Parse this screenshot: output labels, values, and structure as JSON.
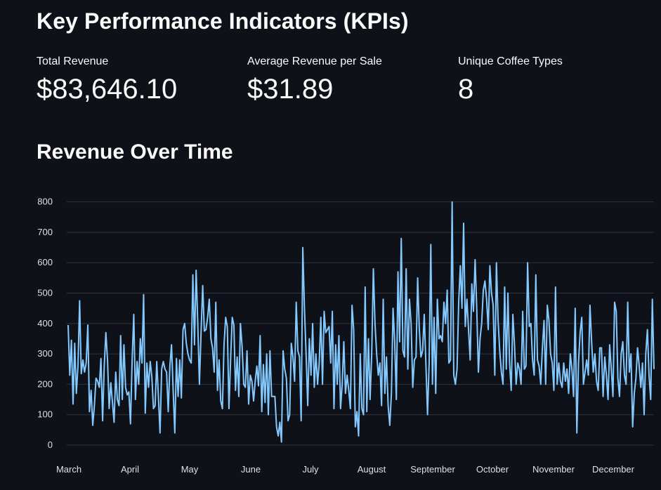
{
  "kpi_section": {
    "title": "Key Performance Indicators (KPIs)",
    "metrics": [
      {
        "label": "Total Revenue",
        "value": "$83,646.10"
      },
      {
        "label": "Average Revenue per Sale",
        "value": "$31.89"
      },
      {
        "label": "Unique Coffee Types",
        "value": "8"
      }
    ]
  },
  "revenue_section": {
    "title": "Revenue Over Time"
  },
  "colors": {
    "background": "#0e1117",
    "line": "#83c9ff",
    "grid": "#31333f",
    "tick_text": "#e0e0e0"
  },
  "chart_data": {
    "type": "line",
    "title": "",
    "xlabel": "",
    "ylabel": "",
    "ylim": [
      0,
      850
    ],
    "yticks": [
      0,
      100,
      200,
      300,
      400,
      500,
      600,
      700,
      800
    ],
    "month_labels": [
      "March",
      "April",
      "May",
      "June",
      "July",
      "August",
      "September",
      "October",
      "November",
      "December"
    ],
    "grid": true,
    "legend": "none",
    "series": [
      {
        "values": [
          395,
          230,
          345,
          135,
          335,
          170,
          260,
          475,
          235,
          280,
          240,
          270,
          395,
          110,
          180,
          65,
          130,
          220,
          210,
          190,
          285,
          80,
          260,
          370,
          280,
          120,
          205,
          140,
          75,
          240,
          150,
          130,
          360,
          150,
          330,
          190,
          165,
          175,
          70,
          280,
          430,
          150,
          275,
          200,
          350,
          270,
          495,
          105,
          270,
          190,
          275,
          225,
          120,
          130,
          275,
          160,
          40,
          250,
          275,
          250,
          240,
          110,
          260,
          330,
          180,
          40,
          285,
          160,
          280,
          155,
          380,
          400,
          335,
          300,
          280,
          270,
          560,
          330,
          575,
          400,
          200,
          370,
          525,
          375,
          380,
          420,
          480,
          350,
          320,
          240,
          470,
          180,
          280,
          145,
          120,
          330,
          420,
          390,
          120,
          280,
          420,
          395,
          180,
          290,
          160,
          400,
          325,
          200,
          190,
          310,
          135,
          230,
          210,
          145,
          210,
          260,
          195,
          360,
          110,
          265,
          140,
          300,
          100,
          310,
          160,
          160,
          160,
          60,
          30,
          75,
          10,
          310,
          250,
          220,
          80,
          100,
          335,
          290,
          210,
          470,
          310,
          290,
          80,
          650,
          450,
          300,
          130,
          350,
          230,
          400,
          190,
          300,
          200,
          270,
          420,
          200,
          440,
          370,
          380,
          390,
          270,
          440,
          120,
          330,
          200,
          360,
          120,
          200,
          340,
          170,
          230,
          180,
          120,
          460,
          380,
          60,
          110,
          30,
          300,
          120,
          100,
          520,
          110,
          350,
          150,
          300,
          580,
          400,
          300,
          230,
          270,
          130,
          480,
          170,
          290,
          130,
          65,
          170,
          450,
          340,
          150,
          570,
          340,
          680,
          310,
          290,
          580,
          250,
          480,
          400,
          190,
          280,
          290,
          550,
          380,
          290,
          310,
          430,
          270,
          100,
          270,
          660,
          200,
          420,
          170,
          480,
          350,
          360,
          340,
          470,
          400,
          510,
          270,
          280,
          800,
          230,
          200,
          250,
          470,
          590,
          450,
          730,
          390,
          480,
          380,
          280,
          530,
          440,
          610,
          450,
          240,
          350,
          400,
          510,
          540,
          480,
          380,
          590,
          500,
          460,
          230,
          600,
          410,
          310,
          240,
          200,
          520,
          250,
          500,
          270,
          180,
          430,
          330,
          200,
          270,
          250,
          200,
          440,
          250,
          260,
          600,
          390,
          400,
          280,
          230,
          560,
          280,
          260,
          200,
          320,
          410,
          200,
          460,
          410,
          300,
          270,
          180,
          520,
          200,
          270,
          210,
          190,
          270,
          210,
          250,
          170,
          300,
          250,
          160,
          450,
          40,
          270,
          370,
          420,
          200,
          240,
          280,
          230,
          460,
          340,
          240,
          300,
          210,
          180,
          320,
          320,
          160,
          290,
          230,
          150,
          330,
          250,
          160,
          470,
          440,
          220,
          160,
          300,
          340,
          230,
          200,
          470,
          240,
          300,
          60,
          170,
          220,
          320,
          260,
          190,
          270,
          100,
          300,
          380,
          230,
          150,
          480,
          250
        ]
      }
    ]
  }
}
